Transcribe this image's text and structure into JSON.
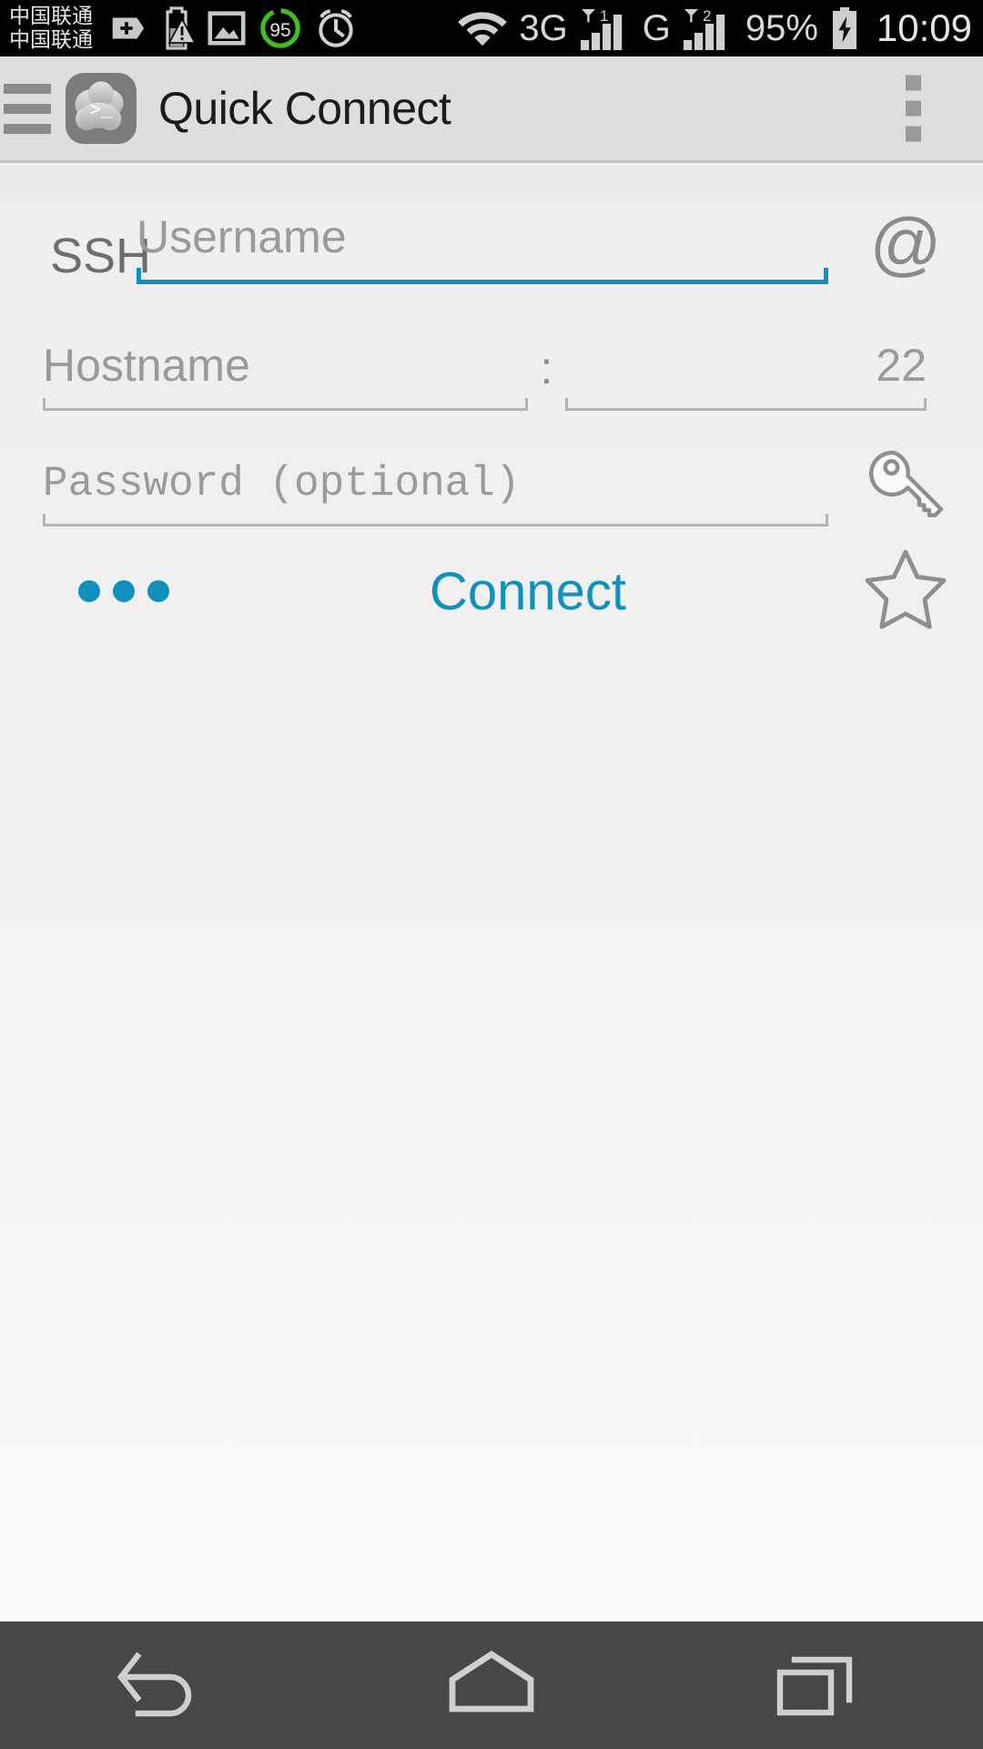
{
  "statusbar": {
    "carrier_line1": "中国联通",
    "carrier_line2": "中国联通",
    "icons": [
      "add-hexagon-icon",
      "battery-warning-icon",
      "image-icon",
      "score-95-icon",
      "alarm-clock-icon",
      "wifi-icon"
    ],
    "score_badge": "95",
    "network_1": "3G",
    "network_1_sim": "1",
    "network_2": "G",
    "network_2_sim": "2",
    "battery_percent": "95%",
    "battery_icon": "battery-charging-icon",
    "clock": "10:09"
  },
  "appbar": {
    "menu_icon": "hamburger-menu-icon",
    "logo_icon": "cloud-terminal-logo",
    "logo_glyph": ">_",
    "title": "Quick Connect",
    "overflow_icon": "overflow-menu-icon"
  },
  "form": {
    "protocol_label": "SSH",
    "username": {
      "value": "",
      "placeholder": "Username",
      "focused": true
    },
    "at_icon": "at-sign-icon",
    "hostname": {
      "value": "",
      "placeholder": "Hostname",
      "focused": false
    },
    "port_separator": ":",
    "port": {
      "value": "22",
      "placeholder": "22",
      "focused": false
    },
    "password": {
      "value": "",
      "placeholder": "Password (optional)",
      "focused": false
    },
    "key_icon": "key-icon",
    "more_options_icon": "ellipsis-icon",
    "connect_label": "Connect",
    "favorite_icon": "star-outline-icon"
  },
  "navbar": {
    "back_icon": "back-arrow-icon",
    "home_icon": "home-icon",
    "recents_icon": "recent-apps-icon"
  },
  "colors": {
    "accent": "#1290bd",
    "appbar_bg": "#dedede",
    "content_bg": "#f0f0f0",
    "navbar_bg": "#474747",
    "placeholder": "#9a9a9a",
    "underline": "#b4b4b4"
  }
}
